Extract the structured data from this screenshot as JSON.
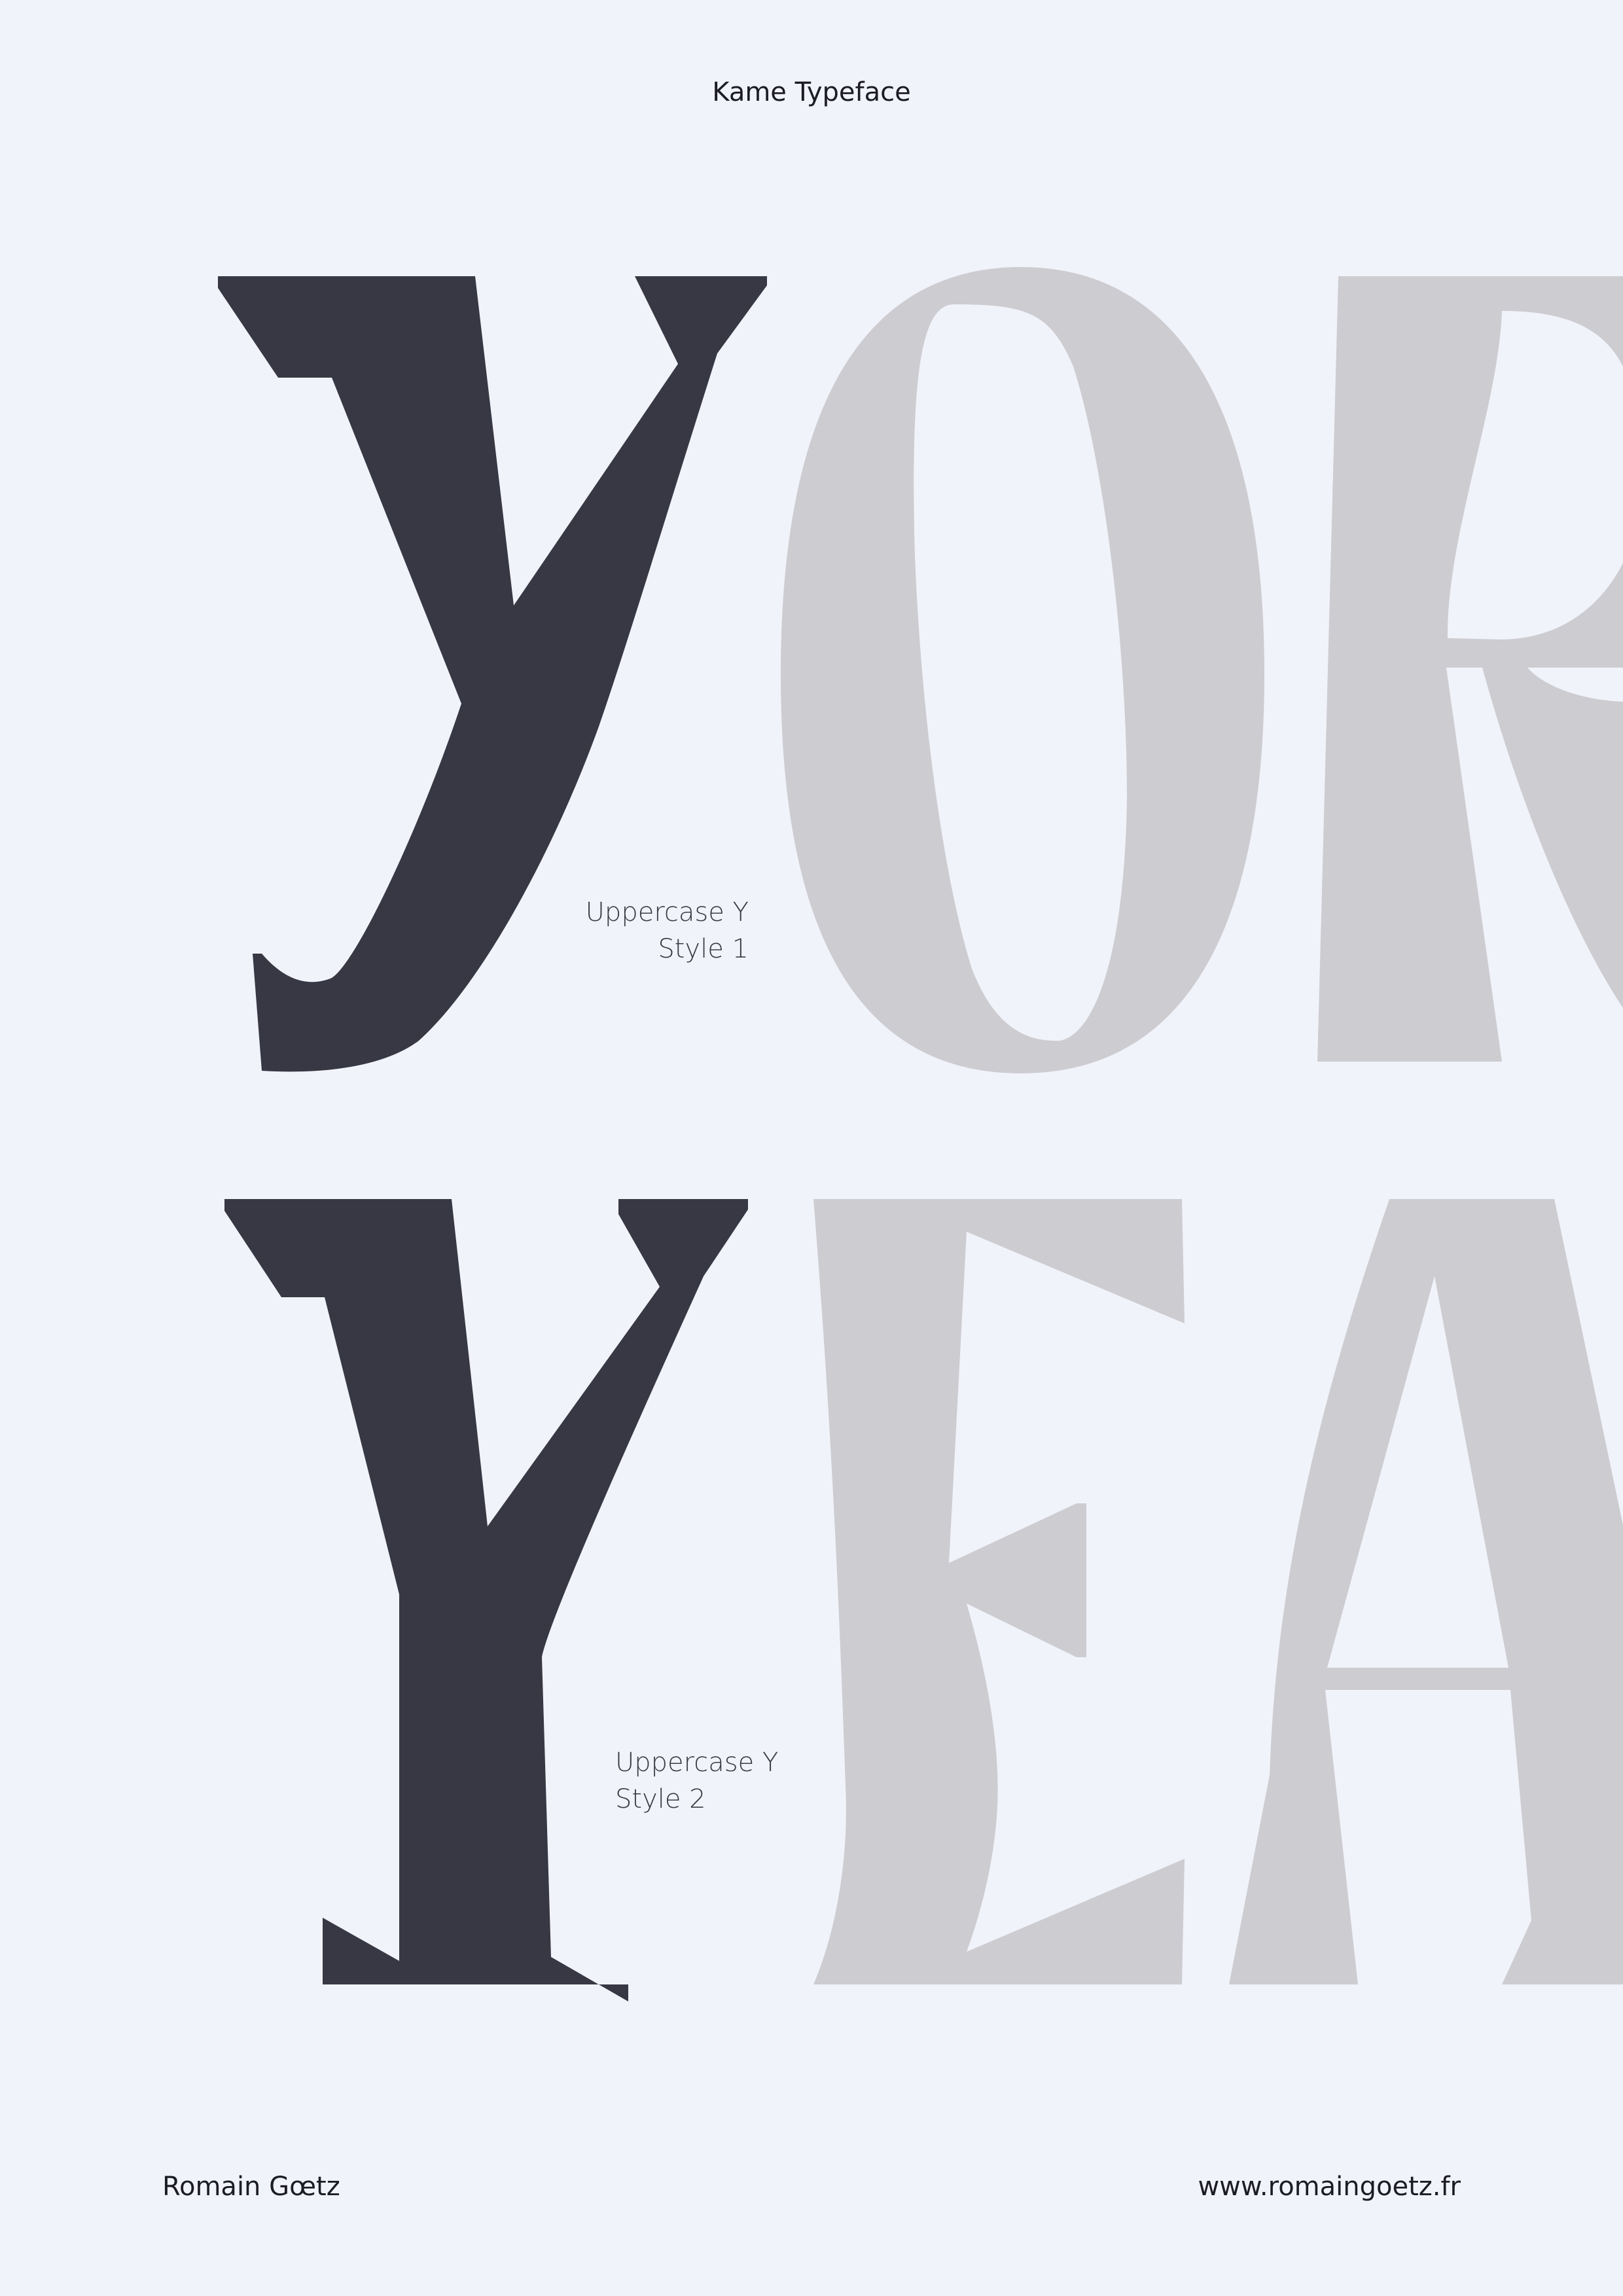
{
  "header": {
    "title": "Kame Typeface"
  },
  "captions": {
    "style1": {
      "line1": "Uppercase Y",
      "line2": "Style 1"
    },
    "style2": {
      "line1": "Uppercase Y",
      "line2": "Style 2"
    }
  },
  "footer": {
    "author": "Romain Gœtz",
    "website": "www.romaingoetz.fr"
  },
  "colors": {
    "background": "#f1f3fa",
    "featured_glyph": "#383844",
    "secondary_glyphs": "#cdccd1",
    "text": "#1c1c24"
  }
}
